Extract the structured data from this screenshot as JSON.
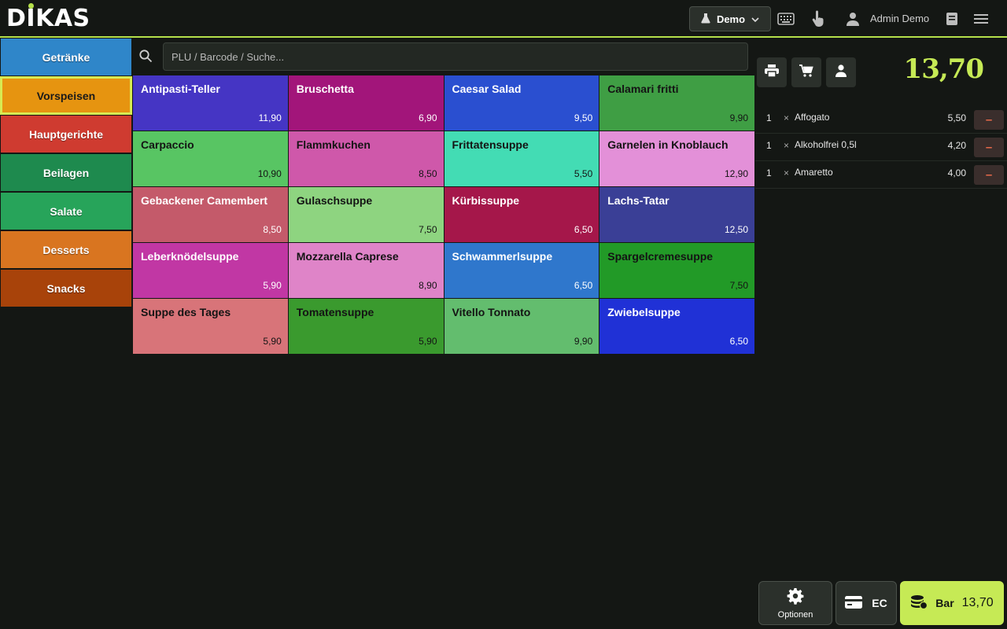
{
  "header": {
    "logo": {
      "pre": "D",
      "mid": "I",
      "post": "KAS"
    },
    "environment": "Demo",
    "user_name": "Admin Demo",
    "icons": [
      "flask-icon",
      "chevron-down-icon",
      "keyboard-icon",
      "touch-icon",
      "user-icon",
      "book-icon",
      "menu-icon"
    ]
  },
  "categories": [
    {
      "label": "Getränke",
      "color": "#2f86c9",
      "active": false
    },
    {
      "label": "Vorspeisen",
      "color": "#e69410",
      "active": true
    },
    {
      "label": "Hauptgerichte",
      "color": "#cf3b30",
      "active": false
    },
    {
      "label": "Beilagen",
      "color": "#1e8a4e",
      "active": false
    },
    {
      "label": "Salate",
      "color": "#27a45a",
      "active": false
    },
    {
      "label": "Desserts",
      "color": "#d97520",
      "active": false
    },
    {
      "label": "Snacks",
      "color": "#a8430a",
      "active": false
    }
  ],
  "search": {
    "placeholder": "PLU / Barcode / Suche..."
  },
  "products": [
    {
      "name": "Antipasti-Teller",
      "price": "11,90",
      "color": "#4535c4",
      "text": "#ffffff"
    },
    {
      "name": "Bruschetta",
      "price": "6,90",
      "color": "#a2157a",
      "text": "#ffffff"
    },
    {
      "name": "Caesar Salad",
      "price": "9,50",
      "color": "#2a4fd0",
      "text": "#ffffff"
    },
    {
      "name": "Calamari fritti",
      "price": "9,90",
      "color": "#3f9e44",
      "text": "#141414"
    },
    {
      "name": "Carpaccio",
      "price": "10,90",
      "color": "#58c563",
      "text": "#141414"
    },
    {
      "name": "Flammkuchen",
      "price": "8,50",
      "color": "#cf58aa",
      "text": "#141414"
    },
    {
      "name": "Frittatensuppe",
      "price": "5,50",
      "color": "#43dcb4",
      "text": "#141414"
    },
    {
      "name": "Garnelen in Knoblauch",
      "price": "12,90",
      "color": "#e390d8",
      "text": "#141414"
    },
    {
      "name": "Gebackener Camembert",
      "price": "8,50",
      "color": "#c45a6a",
      "text": "#ffffff"
    },
    {
      "name": "Gulaschsuppe",
      "price": "7,50",
      "color": "#8ed480",
      "text": "#141414"
    },
    {
      "name": "Kürbissuppe",
      "price": "6,50",
      "color": "#a5174a",
      "text": "#ffffff"
    },
    {
      "name": "Lachs-Tatar",
      "price": "12,50",
      "color": "#3a3f96",
      "text": "#ffffff"
    },
    {
      "name": "Leberknödelsuppe",
      "price": "5,90",
      "color": "#c137a4",
      "text": "#ffffff"
    },
    {
      "name": "Mozzarella Caprese",
      "price": "8,90",
      "color": "#df84c8",
      "text": "#141414"
    },
    {
      "name": "Schwammerlsuppe",
      "price": "6,50",
      "color": "#2f77cc",
      "text": "#ffffff"
    },
    {
      "name": "Spargelcremesuppe",
      "price": "7,50",
      "color": "#229a27",
      "text": "#141414"
    },
    {
      "name": "Suppe des Tages",
      "price": "5,90",
      "color": "#d87479",
      "text": "#141414"
    },
    {
      "name": "Tomatensuppe",
      "price": "5,90",
      "color": "#3a9a2e",
      "text": "#141414"
    },
    {
      "name": "Vitello Tonnato",
      "price": "9,90",
      "color": "#63bd6e",
      "text": "#141414"
    },
    {
      "name": "Zwiebelsuppe",
      "price": "6,50",
      "color": "#2031d6",
      "text": "#ffffff"
    }
  ],
  "cart": {
    "total": "13,70",
    "items": [
      {
        "qty": "1",
        "times": "×",
        "name": "Affogato",
        "price": "5,50",
        "remove": "–"
      },
      {
        "qty": "1",
        "times": "×",
        "name": "Alkoholfrei 0,5l",
        "price": "4,20",
        "remove": "–"
      },
      {
        "qty": "1",
        "times": "×",
        "name": "Amaretto",
        "price": "4,00",
        "remove": "–"
      }
    ]
  },
  "footer": {
    "options_label": "Optionen",
    "ec_label": "EC",
    "bar_label": "Bar",
    "bar_total": "13,70"
  }
}
